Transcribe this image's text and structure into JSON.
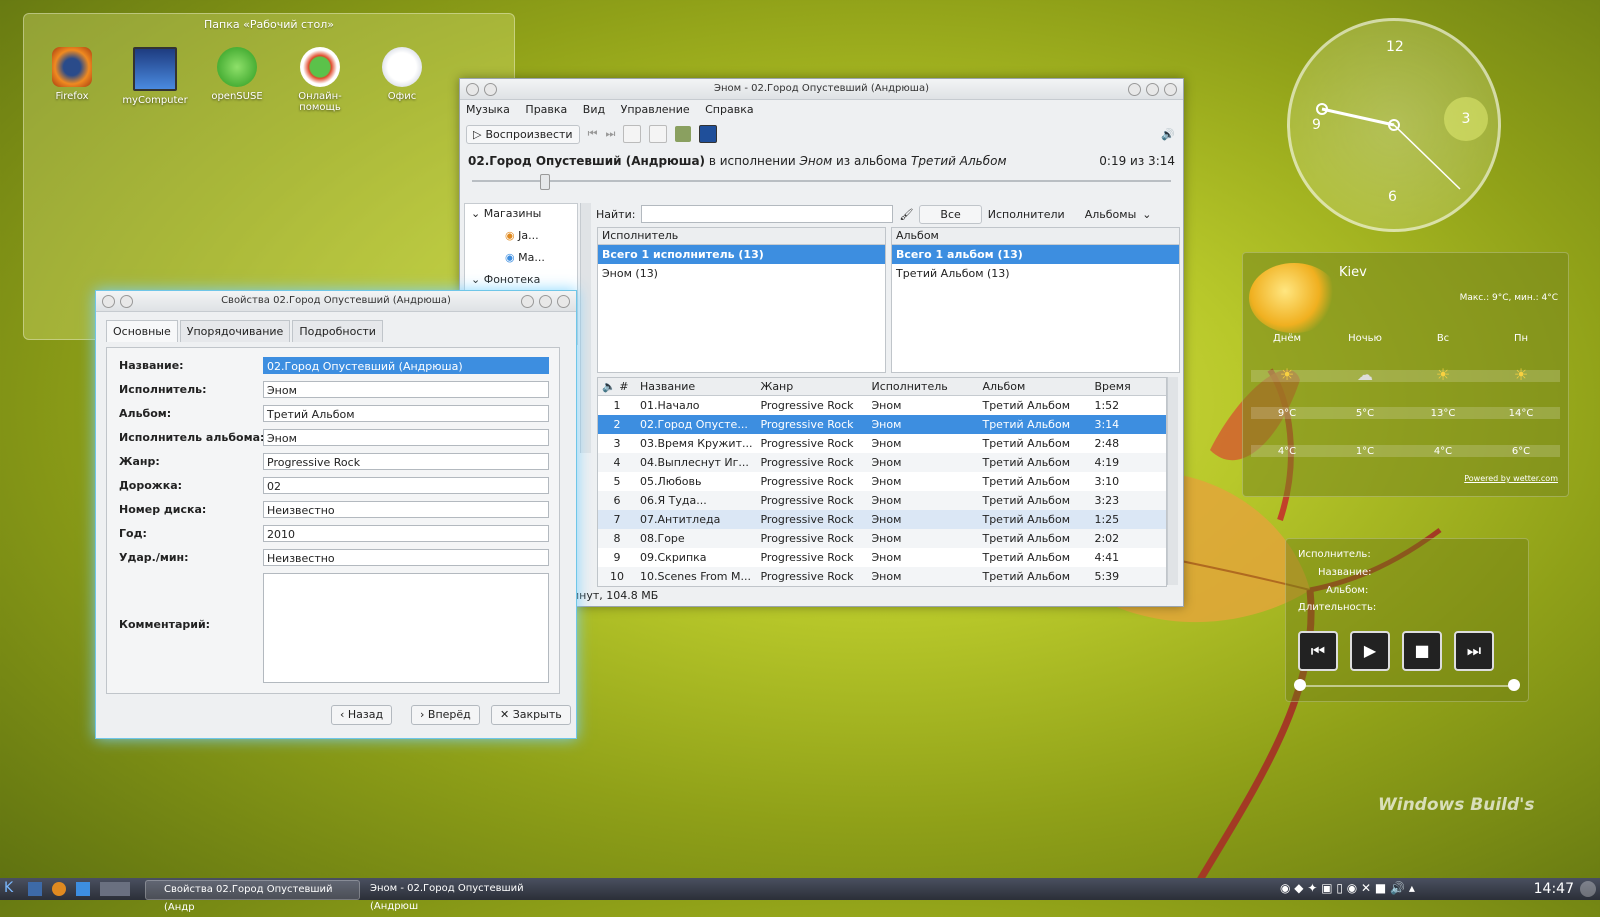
{
  "desktop": {
    "folder_title": "Папка «Рабочий стол»",
    "icons": [
      "Firefox",
      "myComputer",
      "openSUSE",
      "Онлайн-помощь",
      "Офис"
    ],
    "watermark": "Windows Build's"
  },
  "main_window": {
    "title": "Эном - 02.Город Опустевший (Андрюша)",
    "menu": [
      "Музыка",
      "Правка",
      "Вид",
      "Управление",
      "Справка"
    ],
    "play_label": "Воспроизвести",
    "now_playing": {
      "track": "02.Город Опустевший (Андрюша)",
      "by": "в исполнении",
      "artist": "Эном",
      "from": "из альбома",
      "album": "Третий Альбом",
      "time": "0:19 из 3:14"
    },
    "sidebar": [
      "Магазины",
      "Ja...",
      "Ma...",
      "Фонотека"
    ],
    "search_label": "Найти:",
    "filter_tabs": [
      "Все",
      "Исполнители",
      "Альбомы"
    ],
    "artist_pane": {
      "header": "Исполнитель",
      "rows": [
        "Всего 1 исполнитель (13)",
        "Эном (13)"
      ]
    },
    "album_pane": {
      "header": "Альбом",
      "rows": [
        "Всего 1 альбом (13)",
        "Третий Альбом (13)"
      ]
    },
    "track_headers": [
      "#",
      "Название",
      "Жанр",
      "Исполнитель",
      "Альбом",
      "Время"
    ],
    "tracks": [
      [
        "1",
        "01.Начало",
        "Progressive Rock",
        "Эном",
        "Третий Альбом",
        "1:52"
      ],
      [
        "2",
        "02.Город Опусте...",
        "Progressive Rock",
        "Эном",
        "Третий Альбом",
        "3:14"
      ],
      [
        "3",
        "03.Время Кружит...",
        "Progressive Rock",
        "Эном",
        "Третий Альбом",
        "2:48"
      ],
      [
        "4",
        "04.Выплеснут Иг...",
        "Progressive Rock",
        "Эном",
        "Третий Альбом",
        "4:19"
      ],
      [
        "5",
        "05.Любовь",
        "Progressive Rock",
        "Эном",
        "Третий Альбом",
        "3:10"
      ],
      [
        "6",
        "06.Я Туда...",
        "Progressive Rock",
        "Эном",
        "Третий Альбом",
        "3:23"
      ],
      [
        "7",
        "07.Антитледа",
        "Progressive Rock",
        "Эном",
        "Третий Альбом",
        "1:25"
      ],
      [
        "8",
        "08.Горе",
        "Progressive Rock",
        "Эном",
        "Третий Альбом",
        "2:02"
      ],
      [
        "9",
        "09.Скрипка",
        "Progressive Rock",
        "Эном",
        "Третий Альбом",
        "4:41"
      ],
      [
        "10",
        "10.Scenes From M...",
        "Progressive Rock",
        "Эном",
        "Третий Альбом",
        "5:39"
      ]
    ],
    "status": "инут, 104.8 МБ"
  },
  "properties": {
    "title": "Свойства 02.Город Опустевший (Андрюша)",
    "tabs": [
      "Основные",
      "Упорядочивание",
      "Подробности"
    ],
    "fields": [
      {
        "label": "Название:",
        "value": "02.Город Опустевший (Андрюша)"
      },
      {
        "label": "Исполнитель:",
        "value": "Эном"
      },
      {
        "label": "Альбом:",
        "value": "Третий Альбом"
      },
      {
        "label": "Исполнитель альбома:",
        "value": "Эном"
      },
      {
        "label": "Жанр:",
        "value": "Progressive Rock"
      },
      {
        "label": "Дорожка:",
        "value": "02"
      },
      {
        "label": "Номер диска:",
        "value": "Неизвестно"
      },
      {
        "label": "Год:",
        "value": "2010"
      },
      {
        "label": "Удар./мин:",
        "value": "Неизвестно"
      },
      {
        "label": "Комментарий:",
        "value": ""
      }
    ],
    "buttons": [
      "Назад",
      "Вперёд",
      "Закрыть"
    ]
  },
  "clock": {
    "numbers": [
      "12",
      "3",
      "6",
      "9"
    ],
    "date_badge": "3"
  },
  "weather": {
    "city": "Kiev",
    "range": "Макс.: 9°C, мин.: 4°C",
    "days": [
      "Днём",
      "Ночью",
      "Вс",
      "Пн"
    ],
    "highs": [
      "9°C",
      "5°C",
      "13°C",
      "14°C"
    ],
    "lows": [
      "4°C",
      "1°C",
      "4°C",
      "6°C"
    ],
    "credit": "Powered by wetter.com"
  },
  "player": {
    "labels": [
      "Исполнитель:",
      "Название:",
      "Альбом:",
      "Длительность:"
    ]
  },
  "taskbar": {
    "tasks": [
      "Свойства 02.Город Опустевший (Андр",
      "Эном - 02.Город Опустевший (Андрюш"
    ],
    "time": "14:47"
  }
}
